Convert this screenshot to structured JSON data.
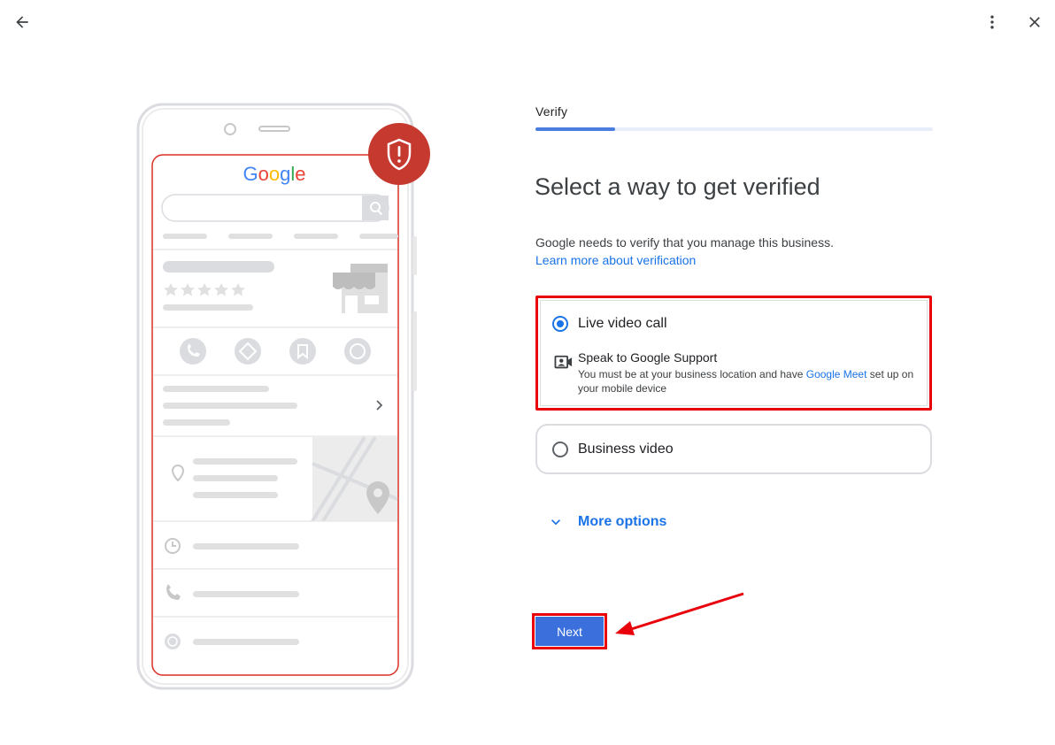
{
  "header": {
    "back_icon": "arrow-back-icon",
    "menu_icon": "more-vert-icon",
    "close_icon": "close-icon"
  },
  "illustration": {
    "brand_letters": [
      {
        "ch": "G",
        "color": "#4285F4"
      },
      {
        "ch": "o",
        "color": "#EA4335"
      },
      {
        "ch": "o",
        "color": "#FBBC05"
      },
      {
        "ch": "g",
        "color": "#4285F4"
      },
      {
        "ch": "l",
        "color": "#34A853"
      },
      {
        "ch": "e",
        "color": "#EA4335"
      }
    ],
    "badge_icon": "shield-alert-icon",
    "badge_color": "#c5392f",
    "outline_color": "#d93025"
  },
  "step": {
    "label": "Verify",
    "progress": 0.2
  },
  "main": {
    "title": "Select a way to get verified",
    "description": "Google needs to verify that you manage this business.",
    "learn_more": "Learn more about verification"
  },
  "options": [
    {
      "label": "Live video call",
      "selected": true,
      "sub_title": "Speak to Google Support",
      "sub_desc_before": "You must be at your business location and have ",
      "sub_desc_link": "Google Meet",
      "sub_desc_after": " set up on your mobile device",
      "icon": "video-contact-icon"
    },
    {
      "label": "Business video",
      "selected": false
    }
  ],
  "more_options": "More options",
  "next_button": "Next",
  "colors": {
    "accent": "#1a73e8",
    "button": "#3a6fdc",
    "highlight": "#e8000a"
  }
}
